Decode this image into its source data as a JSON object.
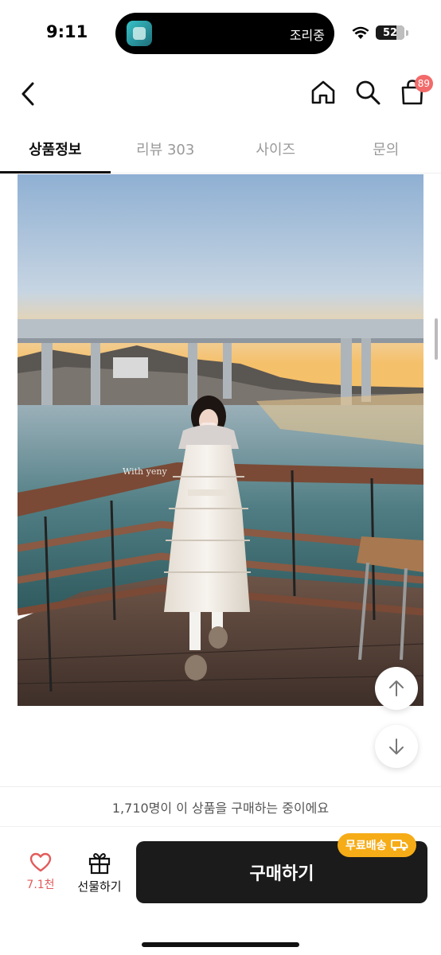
{
  "status_bar": {
    "time": "9:11",
    "island_text": "조리중",
    "battery": "52",
    "wifi_icon": "wifi-icon"
  },
  "nav": {
    "back_icon": "chevron-left-icon",
    "home_icon": "home-icon",
    "search_icon": "search-icon",
    "cart_icon": "shopping-bag-icon",
    "cart_badge": "89"
  },
  "tabs": [
    {
      "label": "상품정보",
      "active": true
    },
    {
      "label": "리뷰 303",
      "active": false
    },
    {
      "label": "사이즈",
      "active": false
    },
    {
      "label": "문의",
      "active": false
    }
  ],
  "photo": {
    "watermark": "With yeny"
  },
  "fabs": {
    "up_icon": "arrow-up-icon",
    "down_icon": "arrow-down-icon"
  },
  "bottom": {
    "buyers_text": "1,710명이 이 상품을 구매하는 중이에요",
    "like_count": "7.1천",
    "gift_label": "선물하기",
    "buy_label": "구매하기",
    "shipping_badge": "무료배송"
  },
  "colors": {
    "accent": "#f6ac17",
    "like": "#e35a5a",
    "badge": "#f26a6a",
    "buy_button": "#1b1b1b"
  }
}
